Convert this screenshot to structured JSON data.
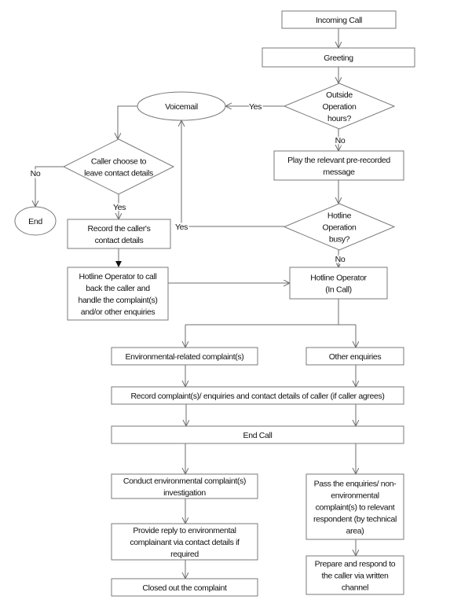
{
  "nodes": {
    "incoming_call": {
      "shape": "rect",
      "lines": [
        "Incoming Call"
      ]
    },
    "greeting": {
      "shape": "rect",
      "lines": [
        "Greeting"
      ]
    },
    "outside_hours": {
      "shape": "diamond",
      "lines": [
        "Outside",
        "Operation",
        "hours?"
      ]
    },
    "voicemail": {
      "shape": "ellipse",
      "lines": [
        "Voicemail"
      ]
    },
    "caller_choose": {
      "shape": "diamond",
      "lines": [
        "Caller choose to",
        "leave contact details"
      ]
    },
    "end": {
      "shape": "ellipse",
      "lines": [
        "End"
      ]
    },
    "record_caller": {
      "shape": "rect",
      "lines": [
        "Record the caller's",
        "contact details"
      ]
    },
    "callback": {
      "shape": "rect",
      "lines": [
        "Hotline Operator to call",
        "back the caller and",
        "handle the complaint(s)",
        "and/or other enquiries"
      ]
    },
    "play_message": {
      "shape": "rect",
      "lines": [
        "Play the relevant pre-recorded",
        "message"
      ]
    },
    "busy": {
      "shape": "diamond",
      "lines": [
        "Hotline",
        "Operation",
        "busy?"
      ]
    },
    "in_call": {
      "shape": "rect",
      "lines": [
        "Hotline Operator",
        "(In Call)"
      ]
    },
    "env_complaint": {
      "shape": "rect",
      "lines": [
        "Environmental-related complaint(s)"
      ]
    },
    "other_enquiries": {
      "shape": "rect",
      "lines": [
        "Other enquiries"
      ]
    },
    "record_complaint": {
      "shape": "rect",
      "lines": [
        "Record complaint(s)/ enquiries and contact details of caller (if caller agrees)"
      ]
    },
    "end_call": {
      "shape": "rect",
      "lines": [
        "End Call"
      ]
    },
    "conduct": {
      "shape": "rect",
      "lines": [
        "Conduct environmental complaint(s)",
        "investigation"
      ]
    },
    "provide_reply": {
      "shape": "rect",
      "lines": [
        "Provide reply to environmental",
        "complainant via contact details if",
        "required"
      ]
    },
    "closed_out": {
      "shape": "rect",
      "lines": [
        "Closed out the complaint"
      ]
    },
    "pass_enquiries": {
      "shape": "rect",
      "lines": [
        "Pass the enquiries/ non-",
        "environmental",
        "complaint(s) to relevant",
        "respondent (by technical",
        "area)"
      ]
    },
    "prepare_respond": {
      "shape": "rect",
      "lines": [
        "Prepare and respond to",
        "the caller via written",
        "channel"
      ]
    }
  },
  "edge_labels": {
    "outside_yes": "Yes",
    "outside_no": "No",
    "choose_no": "No",
    "choose_yes": "Yes",
    "busy_yes": "Yes",
    "busy_no": "No"
  },
  "colors": {
    "line": "#6e6e6e",
    "border": "#7a7a7a",
    "text": "#111111"
  }
}
